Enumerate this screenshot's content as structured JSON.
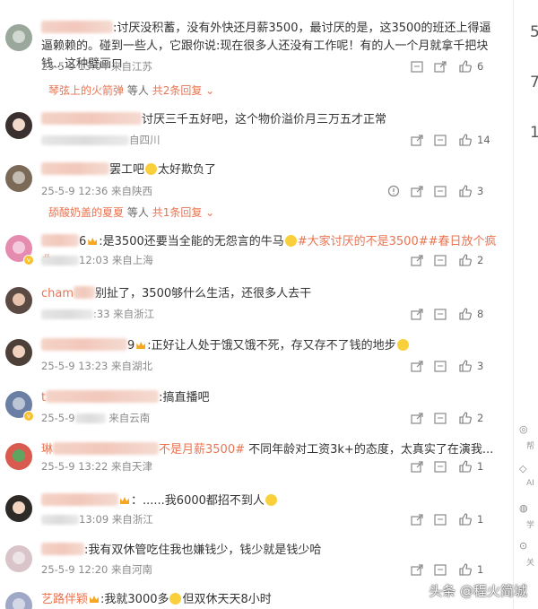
{
  "comments": [
    {
      "text": ":讨厌没积蓄，没有外快还月薪3500，最讨厌的是，这3500的班还上得逼逼赖赖的。碰到一些人，它跟你说:现在很多人还没有工作呢！有的人一个月就拿千把块钱…这种璧画ロ",
      "date": "25-5-9 13:04",
      "loc": "来自江苏",
      "likes": "6",
      "replies": {
        "user": "琴弦上的火箭弹",
        "mid": "等人",
        "count": "共2条回复"
      }
    },
    {
      "text": "讨厌三千五好吧，这个物价溢价月三万五才正常",
      "date": "",
      "loc": "自四川",
      "likes": "14"
    },
    {
      "text": "罢工吧",
      "tail": "太好欺负了",
      "date": "25-5-9 12:36",
      "loc": "来自陕西",
      "likes": "3",
      "replies": {
        "user": "舔酸奶盖的夏夏",
        "mid": "等人",
        "count": "共1条回复"
      }
    },
    {
      "text": "6",
      "tail": ":是3500还要当全能的无怨言的牛马",
      "topic1": "#大家讨厌的不是3500#",
      "topic2": "#春日放个疯#",
      "date": "12:03",
      "loc": "来自上海",
      "likes": "2"
    },
    {
      "name": "cham",
      "tail": "别扯了，3500够什么生活，还很多人去干",
      "date": ":33",
      "loc": "来自浙江",
      "likes": "8"
    },
    {
      "text": "9",
      "tail": ":正好让人处于饿又饿不死，存又存不了钱的地步",
      "date": "25-5-9 13:23",
      "loc": "来自湖北",
      "likes": "3"
    },
    {
      "name": "t",
      "tail": ":搞直播吧",
      "date": "25-5-9",
      "loc": "来自云南",
      "likes": "2"
    },
    {
      "name": "琳",
      "topic": "不是月薪3500#",
      "tail": " 不同年龄对工资3k+的态度，太真实了在演我...",
      "date": "25-5-9 13:22",
      "loc": "来自天津",
      "likes": "1"
    },
    {
      "tail": "：......我6000都招不到人",
      "date": "13:09",
      "loc": "来自浙江",
      "likes": "1"
    },
    {
      "tail": ":我有双休管吃住我也嫌钱少，钱少就是钱少哈",
      "date": "25-5-9 12:20",
      "loc": "来自河南",
      "likes": "1"
    },
    {
      "name": "艺路伴颖",
      "tail": ":我就3000多",
      "tail2": "但双休天天8小时",
      "date": "",
      "loc": "",
      "likes": ""
    }
  ],
  "right_strip": {
    "nums": [
      "5",
      "7",
      "1"
    ],
    "labels": [
      "帮",
      "AI",
      "学",
      "关"
    ]
  },
  "watermark": "头条 @程火简城",
  "colors": {
    "accent": "#eb7350",
    "text": "#333333",
    "meta": "#8a8a8a"
  },
  "icons": [
    "comment-icon",
    "forward-icon",
    "thumbs-up-icon",
    "report-icon",
    "chevron-down-icon"
  ]
}
